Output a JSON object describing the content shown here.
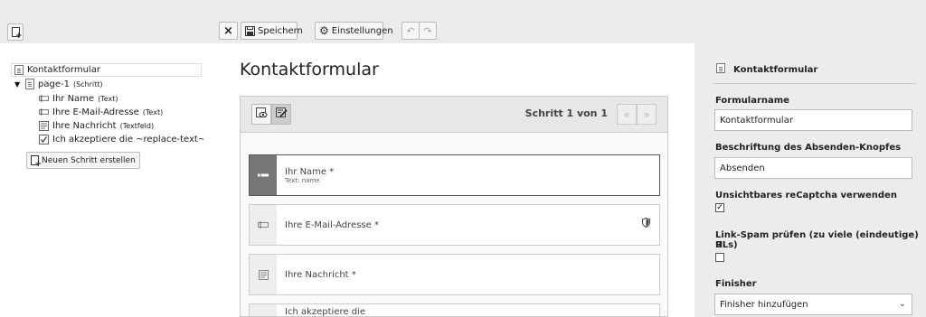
{
  "toolbar": {
    "close_label": "×",
    "save_label": "Speichern",
    "settings_label": "Einstellungen"
  },
  "tree": {
    "root": "Kontaktformular",
    "page": {
      "label": "page-1",
      "type": "(Schritt)"
    },
    "elements": [
      {
        "label": "Ihr Name",
        "type": "(Text)",
        "icon": "text-field-icon"
      },
      {
        "label": "Ihre E-Mail-Adresse",
        "type": "(Text)",
        "icon": "text-field-icon"
      },
      {
        "label": "Ihre Nachricht",
        "type": "(Textfeld)",
        "icon": "textarea-icon"
      },
      {
        "label": "Ich akzeptiere die ~replace-text~pri",
        "type": "",
        "icon": "checkbox-icon"
      }
    ],
    "new_step_label": "Neuen Schritt erstellen"
  },
  "stage": {
    "title": "Kontaktformular",
    "step_indicator": "Schritt 1 von 1",
    "fields": [
      {
        "label": "Ihr Name *",
        "sub": "Text: name"
      },
      {
        "label": "Ihre E-Mail-Adresse *",
        "sub": ""
      },
      {
        "label": "Ihre Nachricht *",
        "sub": ""
      },
      {
        "label": "Ich akzeptiere die",
        "sub": ""
      }
    ]
  },
  "inspector": {
    "title": "Kontaktformular",
    "form_name_label": "Formularname",
    "form_name_value": "Kontaktformular",
    "submit_label_label": "Beschriftung des Absenden-Knopfes",
    "submit_label_value": "Absenden",
    "recaptcha_label": "Unsichtbares reCaptcha verwenden",
    "recaptcha_checked": true,
    "linkspam_label_1": "Link-Spam prüfen (zu viele (eindeutige) U",
    "linkspam_label_2": "RLs)",
    "linkspam_checked": false,
    "finisher_label": "Finisher",
    "finisher_select_value": "Finisher hinzufügen"
  }
}
